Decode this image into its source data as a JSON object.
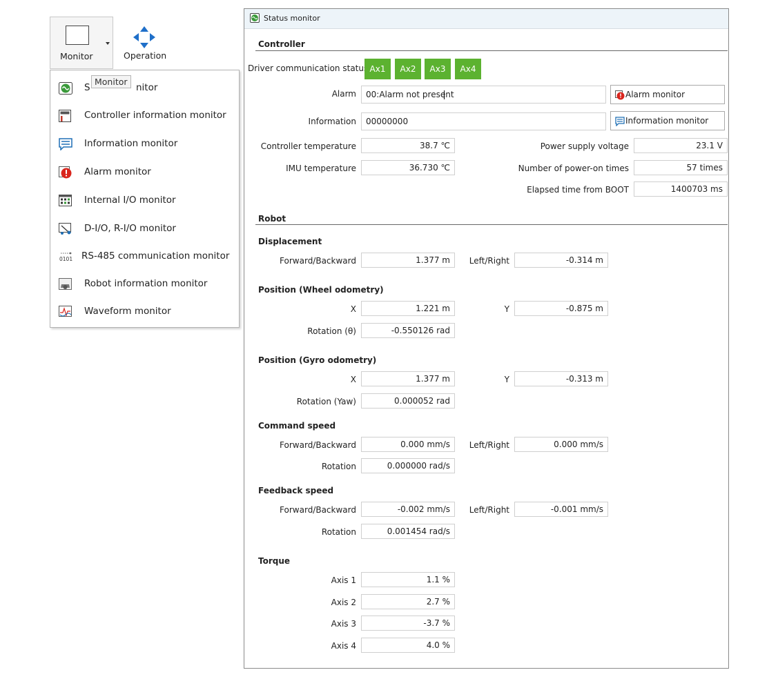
{
  "ribbon": {
    "monitor_label": "Monitor",
    "operation_label": "Operation",
    "tooltip": "Monitor"
  },
  "menu": {
    "items": [
      {
        "icon": "status-monitor-icon",
        "label": "Status monitor",
        "visible_prefix": "S",
        "visible_suffix": "nitor"
      },
      {
        "icon": "controller-information-monitor-icon",
        "label": "Controller information monitor"
      },
      {
        "icon": "information-monitor-icon",
        "label": "Information monitor"
      },
      {
        "icon": "alarm-monitor-icon",
        "label": "Alarm monitor"
      },
      {
        "icon": "internal-io-monitor-icon",
        "label": "Internal I/O monitor"
      },
      {
        "icon": "dio-rio-monitor-icon",
        "label": "D-I/O, R-I/O monitor"
      },
      {
        "icon": "rs485-communication-monitor-icon",
        "label": "RS-485 communication monitor"
      },
      {
        "icon": "robot-information-monitor-icon",
        "label": "Robot information monitor"
      },
      {
        "icon": "waveform-monitor-icon",
        "label": "Waveform monitor"
      }
    ]
  },
  "window": {
    "title": "Status monitor",
    "controller": {
      "heading": "Controller",
      "driver_comm_label": "Driver communication status",
      "axes": [
        "Ax1",
        "Ax2",
        "Ax3",
        "Ax4"
      ],
      "alarm_label": "Alarm",
      "alarm_value": "00:Alarm not present",
      "alarm_button": "Alarm monitor",
      "information_label": "Information",
      "information_value": "00000000",
      "information_button": "Information monitor",
      "controller_temp_label": "Controller temperature",
      "controller_temp_value": "38.7 ℃",
      "imu_temp_label": "IMU temperature",
      "imu_temp_value": "36.730 ℃",
      "power_supply_label": "Power supply voltage",
      "power_supply_value": "23.1 V",
      "power_on_label": "Number of power-on times",
      "power_on_value": "57 times",
      "elapsed_label": "Elapsed time from BOOT",
      "elapsed_value": "1400703 ms"
    },
    "robot": {
      "heading": "Robot",
      "displacement": {
        "heading": "Displacement",
        "fb_label": "Forward/Backward",
        "fb_value": "1.377 m",
        "lr_label": "Left/Right",
        "lr_value": "-0.314 m"
      },
      "wheel_odometry": {
        "heading": "Position (Wheel odometry)",
        "x_label": "X",
        "x_value": "1.221 m",
        "y_label": "Y",
        "y_value": "-0.875 m",
        "rot_label": "Rotation (θ)",
        "rot_value": "-0.550126 rad"
      },
      "gyro_odometry": {
        "heading": "Position (Gyro odometry)",
        "x_label": "X",
        "x_value": "1.377 m",
        "y_label": "Y",
        "y_value": "-0.313 m",
        "rot_label": "Rotation (Yaw)",
        "rot_value": "0.000052 rad"
      },
      "command_speed": {
        "heading": "Command speed",
        "fb_label": "Forward/Backward",
        "fb_value": "0.000 mm/s",
        "lr_label": "Left/Right",
        "lr_value": "0.000 mm/s",
        "rot_label": "Rotation",
        "rot_value": "0.000000 rad/s"
      },
      "feedback_speed": {
        "heading": "Feedback speed",
        "fb_label": "Forward/Backward",
        "fb_value": "-0.002 mm/s",
        "lr_label": "Left/Right",
        "lr_value": "-0.001 mm/s",
        "rot_label": "Rotation",
        "rot_value": "0.001454 rad/s"
      },
      "torque": {
        "heading": "Torque",
        "axes": [
          {
            "label": "Axis 1",
            "value": "1.1 %"
          },
          {
            "label": "Axis 2",
            "value": "2.7 %"
          },
          {
            "label": "Axis 3",
            "value": "-3.7 %"
          },
          {
            "label": "Axis 4",
            "value": "4.0 %"
          }
        ]
      }
    }
  },
  "colors": {
    "axis_ok_green": "#5cb230",
    "status_icon_green": "#3a9a3a",
    "alarm_red": "#d9251d",
    "info_blue": "#1f6fb5",
    "operation_arrow_blue": "#1f6fc9"
  }
}
